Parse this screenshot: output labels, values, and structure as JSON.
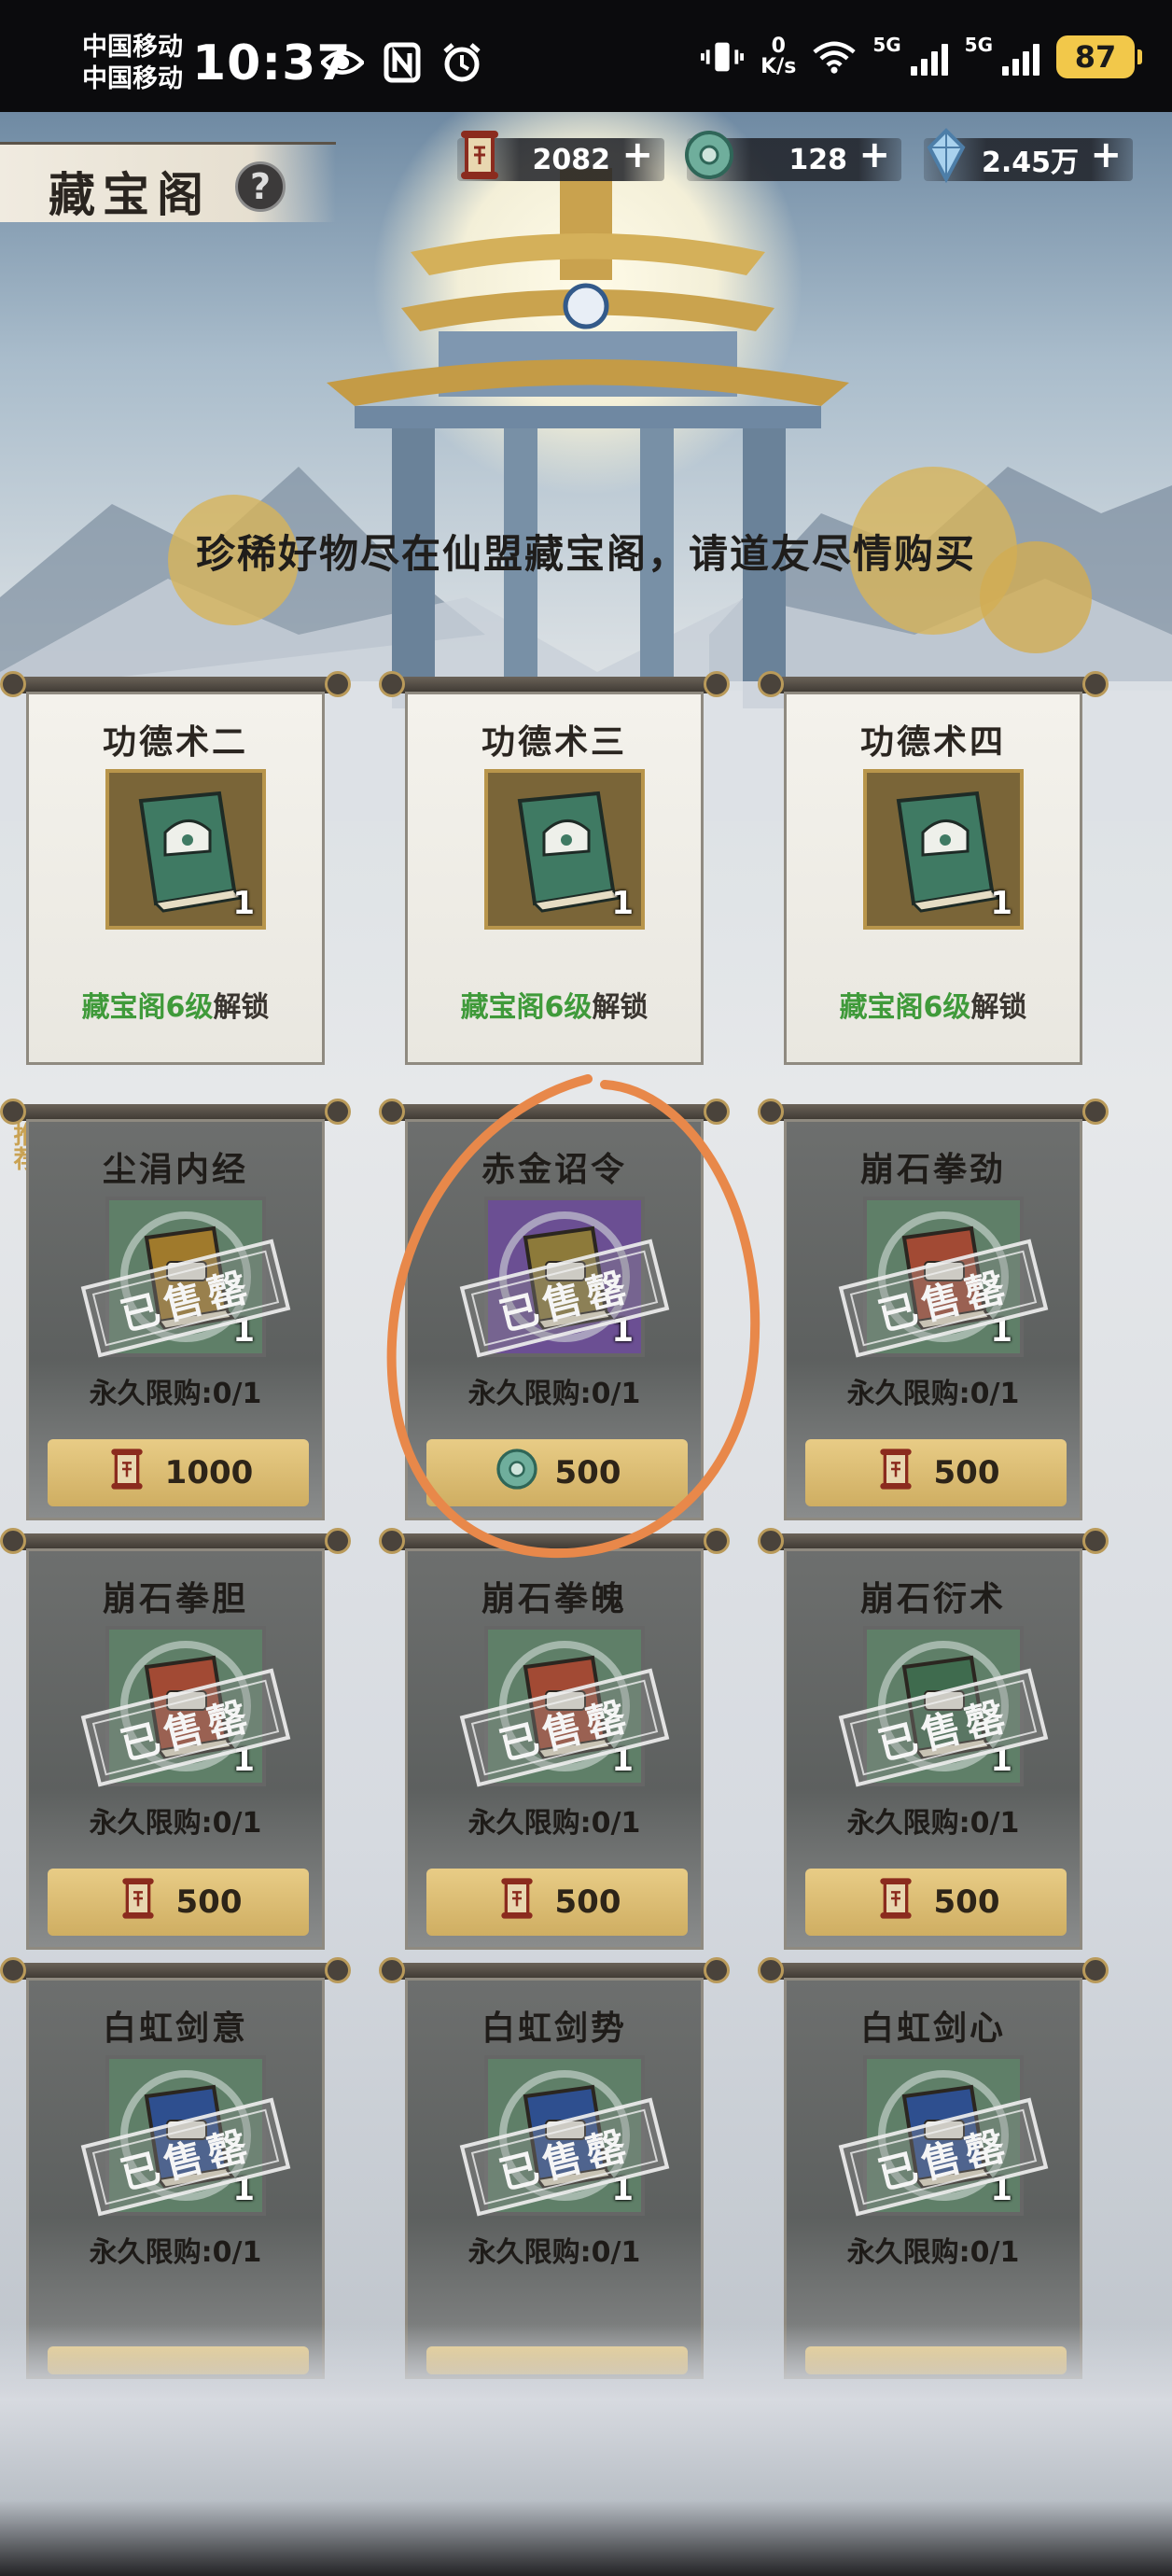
{
  "status_bar": {
    "carrier_1": "中国移动",
    "carrier_2": "中国移动",
    "time": "10:37",
    "net_speed_value": "0",
    "net_speed_unit": "K/s",
    "signal_1": "5G",
    "signal_2": "5G",
    "battery": "87"
  },
  "header": {
    "title": "藏宝阁",
    "help_label": "?",
    "currencies": [
      {
        "icon": "scroll-token-icon",
        "value": "2082",
        "plus": "+"
      },
      {
        "icon": "jade-coin-icon",
        "value": "128",
        "plus": "+"
      },
      {
        "icon": "spirit-crystal-icon",
        "value": "2.45万",
        "plus": "+"
      }
    ]
  },
  "slogan": "珍稀好物尽在仙盟藏宝阁，请道友尽情购买",
  "recommend_tag": "推荐",
  "unlock_items": [
    {
      "name": "功德术二",
      "qty": "1",
      "unlock_highlight": "藏宝阁6级",
      "unlock_suffix": "解锁"
    },
    {
      "name": "功德术三",
      "qty": "1",
      "unlock_highlight": "藏宝阁6级",
      "unlock_suffix": "解锁"
    },
    {
      "name": "功德术四",
      "qty": "1",
      "unlock_highlight": "藏宝阁6级",
      "unlock_suffix": "解锁"
    }
  ],
  "sold_items": [
    {
      "name": "尘涓内经",
      "qty": "1",
      "stamp": "已售罄",
      "limit": "永久限购:0/1",
      "price": "1000",
      "currency": "scroll-token-icon",
      "book_color": "#a07a2c"
    },
    {
      "name": "赤金诏令",
      "qty": "1",
      "stamp": "已售罄",
      "limit": "永久限购:0/1",
      "price": "500",
      "currency": "jade-coin-icon",
      "book_color": "#8d7a3a"
    },
    {
      "name": "崩石拳劲",
      "qty": "1",
      "stamp": "已售罄",
      "limit": "永久限购:0/1",
      "price": "500",
      "currency": "scroll-token-icon",
      "book_color": "#a24a34"
    },
    {
      "name": "崩石拳胆",
      "qty": "1",
      "stamp": "已售罄",
      "limit": "永久限购:0/1",
      "price": "500",
      "currency": "scroll-token-icon",
      "book_color": "#a24a34"
    },
    {
      "name": "崩石拳魄",
      "qty": "1",
      "stamp": "已售罄",
      "limit": "永久限购:0/1",
      "price": "500",
      "currency": "scroll-token-icon",
      "book_color": "#a24a34"
    },
    {
      "name": "崩石衍术",
      "qty": "1",
      "stamp": "已售罄",
      "limit": "永久限购:0/1",
      "price": "500",
      "currency": "scroll-token-icon",
      "book_color": "#3f6b4e"
    },
    {
      "name": "白虹剑意",
      "qty": "1",
      "stamp": "已售罄",
      "limit": "永久限购:0/1",
      "price": "",
      "currency": "scroll-token-icon",
      "book_color": "#2e4f8f"
    },
    {
      "name": "白虹剑势",
      "qty": "1",
      "stamp": "已售罄",
      "limit": "永久限购:0/1",
      "price": "",
      "currency": "scroll-token-icon",
      "book_color": "#2e4f8f"
    },
    {
      "name": "白虹剑心",
      "qty": "1",
      "stamp": "已售罄",
      "limit": "永久限购:0/1",
      "price": "",
      "currency": "scroll-token-icon",
      "book_color": "#2e4f8f"
    }
  ],
  "colors": {
    "unlock_green": "#3f9a3a",
    "price_gold": "#dcbc72",
    "annotation_orange": "#e8884a"
  }
}
